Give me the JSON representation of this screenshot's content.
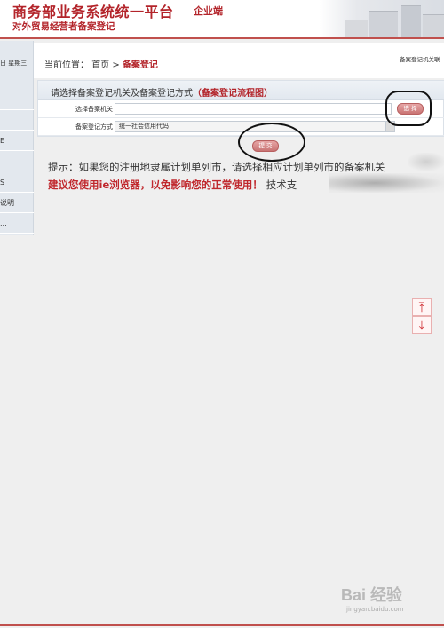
{
  "header": {
    "title": "商务部业务系统统一平台",
    "tag": "企业端",
    "subtitle": "对外贸易经营者备案登记"
  },
  "sidebar": {
    "date": "日 星期三",
    "items": [
      {
        "label": ""
      },
      {
        "label": ""
      },
      {
        "label": "E"
      },
      {
        "label": "S"
      },
      {
        "label": "说明"
      },
      {
        "label": "..."
      }
    ]
  },
  "breadcrumb": {
    "prefix": "当前位置：",
    "home": "首页",
    "sep": " > ",
    "current": "备案登记",
    "right_text": "备案登记机关联"
  },
  "form": {
    "heading": "请选择备案登记机关及备案登记方式",
    "heading_link": "（备案登记流程图）",
    "agency_label": "选择备案机关",
    "agency_value": "",
    "choose_button": "选 择",
    "method_label": "备案登记方式",
    "method_value": "统一社会信用代码",
    "submit_button": "提 交"
  },
  "tips": {
    "line1": "提示：如果您的注册地隶属计划单列市，请选择相应计划单列市的备案机关",
    "line2": "建议您使用ie浏览器，以免影响您的正常使用！",
    "line2_tail": "技术支"
  },
  "scroll": {
    "up": "⤒",
    "down": "⤓"
  },
  "watermark": {
    "main": "Bai 经验",
    "sub": "jingyan.baidu.com"
  },
  "colors": {
    "brand_red": "#b3242a",
    "accent_border": "#c0504d",
    "button_pink": "#c97474"
  }
}
